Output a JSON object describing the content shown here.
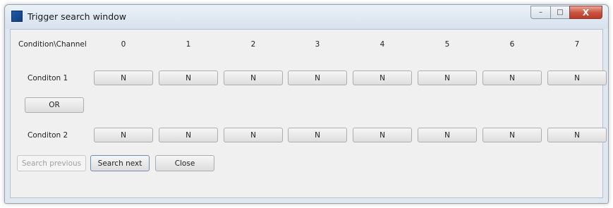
{
  "window": {
    "title": "Trigger search window",
    "minimize_glyph": "–",
    "maximize_glyph": "□",
    "close_glyph": "X"
  },
  "grid": {
    "header_label": "Condition\\Channel",
    "channels": [
      "0",
      "1",
      "2",
      "3",
      "4",
      "5",
      "6",
      "7"
    ],
    "condition1_label": "Conditon 1",
    "condition2_label": "Conditon 2",
    "condition1_values": [
      "N",
      "N",
      "N",
      "N",
      "N",
      "N",
      "N",
      "N"
    ],
    "condition2_values": [
      "N",
      "N",
      "N",
      "N",
      "N",
      "N",
      "N",
      "N"
    ]
  },
  "operator_label": "OR",
  "footer": {
    "search_previous_label": "Search previous",
    "search_next_label": "Search next",
    "close_label": "Close"
  }
}
